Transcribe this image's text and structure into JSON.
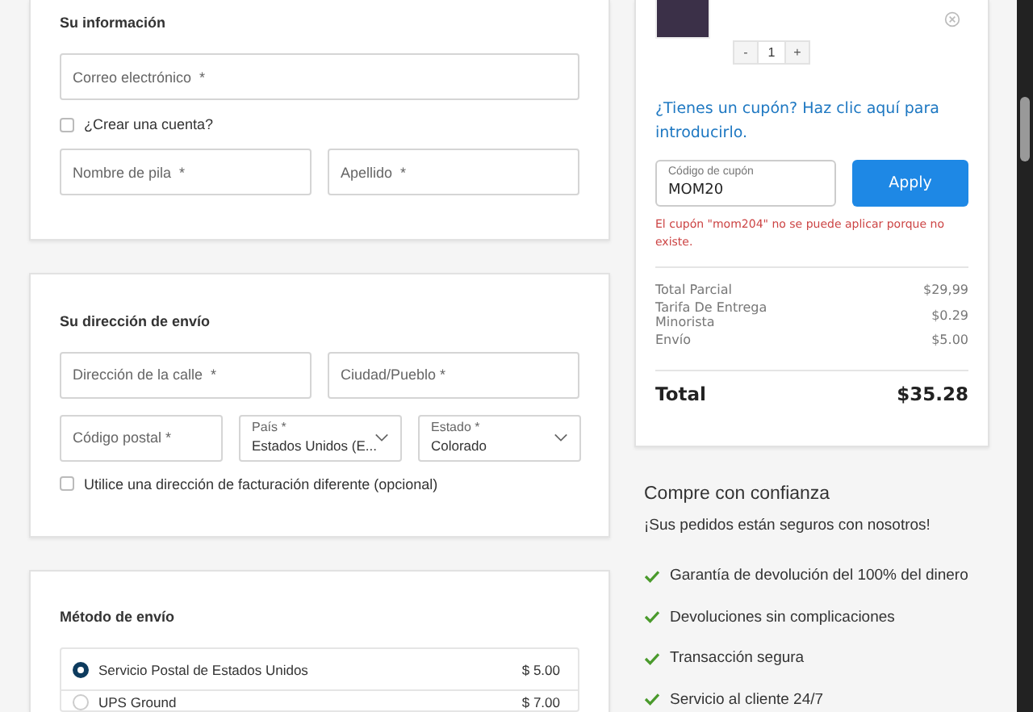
{
  "your_information": {
    "title": "Su información",
    "email": {
      "placeholder": "Correo electrónico  *"
    },
    "create_account": {
      "label": "¿Crear una cuenta?",
      "checked": false
    },
    "first_name": {
      "placeholder": "Nombre de pila  *"
    },
    "last_name": {
      "placeholder": "Apellido  *"
    }
  },
  "shipping_address": {
    "title": "Su dirección de envío",
    "street": {
      "placeholder": "Dirección de la calle  *"
    },
    "city": {
      "placeholder": "Ciudad/Pueblo *"
    },
    "postcode": {
      "placeholder": "Código postal *"
    },
    "country": {
      "label": "País *",
      "value": "Estados Unidos (E..."
    },
    "state": {
      "label": "Estado *",
      "value": "Colorado"
    },
    "different_billing": {
      "label": "Utilice una dirección de facturación diferente (opcional)",
      "checked": false
    }
  },
  "shipping_method": {
    "title": "Método de envío",
    "options": [
      {
        "label": "Servicio Postal de Estados Unidos",
        "price": "$ 5.00",
        "selected": true
      },
      {
        "label": "UPS Ground",
        "price": "$ 7.00",
        "selected": false
      }
    ]
  },
  "cart": {
    "quantity": "1",
    "minus": "-",
    "plus": "+",
    "coupon_prompt": "¿Tienes un cupón? Haz clic aquí para introducirlo.",
    "coupon_field": {
      "label": "Código de cupón",
      "value": "MOM20"
    },
    "apply_button": "Apply",
    "coupon_error": "El cupón \"mom204\" no se puede aplicar porque no existe.",
    "summary": [
      {
        "label": "Total Parcial",
        "value": "$29,99"
      },
      {
        "label": "Tarifa De Entrega Minorista",
        "value": "$0.29"
      },
      {
        "label": "Envío",
        "value": "$5.00"
      }
    ],
    "total": {
      "label": "Total",
      "value": "$35.28"
    }
  },
  "trust": {
    "title": "Compre con confianza",
    "subtitle": "¡Sus pedidos están seguros con nosotros!",
    "items": [
      "Garantía de devolución del 100% del dinero",
      "Devoluciones sin complicaciones",
      "Transacción segura",
      "Servicio al cliente 24/7"
    ]
  }
}
